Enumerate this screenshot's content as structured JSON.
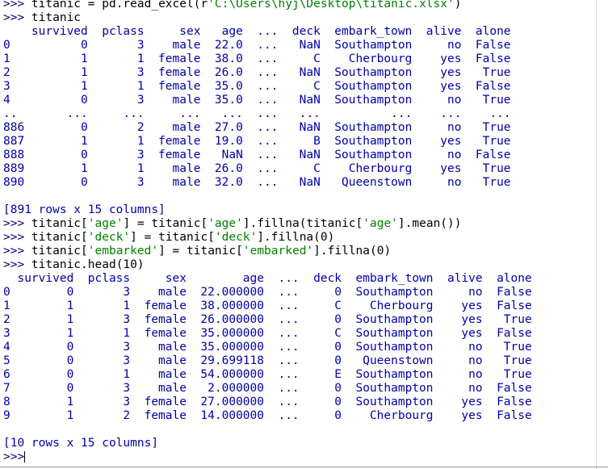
{
  "prompt": ">>>",
  "session": {
    "cmd_read": {
      "pre": " titanic = pd.read_excel(r",
      "str": "'C:\\Users\\hyj\\Desktop\\titanic.xlsx'",
      "post": ")"
    },
    "cmd_show": " titanic",
    "table1": {
      "header": "    survived  pclass     sex   age  ...  deck  embark_town  alive  alone",
      "rows": [
        "0          0       3    male  22.0  ...   NaN  Southampton     no  False",
        "1          1       1  female  38.0  ...     C    Cherbourg    yes  False",
        "2          1       3  female  26.0  ...   NaN  Southampton    yes   True",
        "3          1       1  female  35.0  ...     C  Southampton    yes  False",
        "4          0       3    male  35.0  ...   NaN  Southampton     no   True",
        "..       ...     ...     ...   ...  ...   ...          ...    ...    ...",
        "886        0       2    male  27.0  ...   NaN  Southampton     no   True",
        "887        1       1  female  19.0  ...     B  Southampton    yes   True",
        "888        0       3  female   NaN  ...   NaN  Southampton     no  False",
        "889        1       1    male  26.0  ...     C    Cherbourg    yes   True",
        "890        0       3    male  32.0  ...   NaN   Queenstown     no   True"
      ],
      "summary": "[891 rows x 15 columns]"
    },
    "cmd_age": {
      "a": " titanic[",
      "s1": "'age'",
      "b": "] = titanic[",
      "s2": "'age'",
      "c": "].fillna(titanic[",
      "s3": "'age'",
      "d": "].mean())"
    },
    "cmd_deck": {
      "a": " titanic[",
      "s1": "'deck'",
      "b": "] = titanic[",
      "s2": "'deck'",
      "c": "].fillna(0)"
    },
    "cmd_embarked": {
      "a": " titanic[",
      "s1": "'embarked'",
      "b": "] = titanic[",
      "s2": "'embarked'",
      "c": "].fillna(0)"
    },
    "cmd_head": " titanic.head(10)",
    "table2": {
      "header": "  survived  pclass     sex        age  ...  deck  embark_town  alive  alone",
      "rows": [
        "0        0       3    male  22.000000  ...     0  Southampton     no  False",
        "1        1       1  female  38.000000  ...     C    Cherbourg    yes  False",
        "2        1       3  female  26.000000  ...     0  Southampton    yes   True",
        "3        1       1  female  35.000000  ...     C  Southampton    yes  False",
        "4        0       3    male  35.000000  ...     0  Southampton     no   True",
        "5        0       3    male  29.699118  ...     0   Queenstown     no   True",
        "6        0       1    male  54.000000  ...     E  Southampton     no   True",
        "7        0       3    male   2.000000  ...     0  Southampton     no  False",
        "8        1       3  female  27.000000  ...     0  Southampton    yes  False",
        "9        1       2  female  14.000000  ...     0    Cherbourg    yes  False"
      ],
      "summary": "[10 rows x 15 columns]"
    }
  }
}
